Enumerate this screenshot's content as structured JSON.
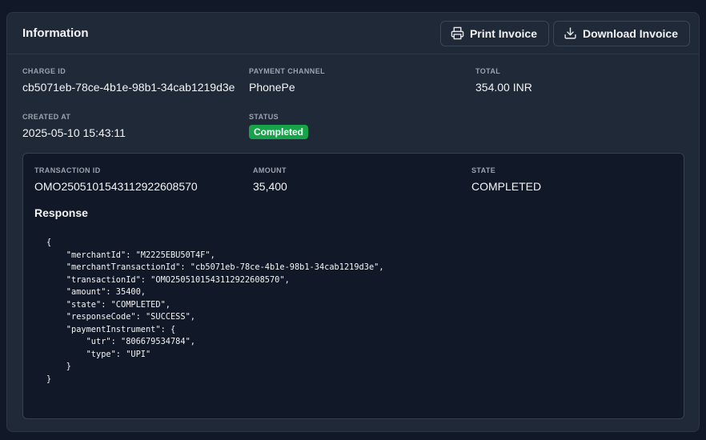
{
  "header": {
    "title": "Information",
    "print_label": "Print Invoice",
    "download_label": "Download Invoice"
  },
  "charge": {
    "charge_id_label": "CHARGE ID",
    "charge_id": "cb5071eb-78ce-4b1e-98b1-34cab1219d3e",
    "payment_channel_label": "PAYMENT CHANNEL",
    "payment_channel": "PhonePe",
    "total_label": "TOTAL",
    "total": "354.00 INR",
    "created_at_label": "CREATED AT",
    "created_at": "2025-05-10 15:43:11",
    "status_label": "STATUS",
    "status": "Completed"
  },
  "transaction": {
    "transaction_id_label": "TRANSACTION ID",
    "transaction_id": "OMO2505101543112922608570",
    "amount_label": "AMOUNT",
    "amount": "35,400",
    "state_label": "STATE",
    "state": "COMPLETED",
    "response_title": "Response",
    "response_json": "{\n    \"merchantId\": \"M2225EBU50T4F\",\n    \"merchantTransactionId\": \"cb5071eb-78ce-4b1e-98b1-34cab1219d3e\",\n    \"transactionId\": \"OMO2505101543112922608570\",\n    \"amount\": 35400,\n    \"state\": \"COMPLETED\",\n    \"responseCode\": \"SUCCESS\",\n    \"paymentInstrument\": {\n        \"utr\": \"806679534784\",\n        \"type\": \"UPI\"\n    }\n}"
  },
  "colors": {
    "page_bg": "#111827",
    "card_bg": "#1f2937",
    "badge_success": "#16a34a"
  },
  "icons": {
    "print": "printer-icon",
    "download": "download-icon"
  }
}
